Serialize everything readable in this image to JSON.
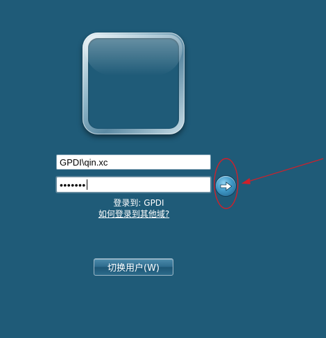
{
  "login": {
    "username_value": "GPDI\\qin.xc",
    "password_mask": "•••••••",
    "domain_text": "登录到: GPDI",
    "other_domain_link": "如何登录到其他域?"
  },
  "switch_user": {
    "label": "切换用户(W)"
  },
  "colors": {
    "background": "#1f5b78",
    "annotation": "#d0202a"
  },
  "icons": {
    "submit": "arrow-right-icon"
  }
}
